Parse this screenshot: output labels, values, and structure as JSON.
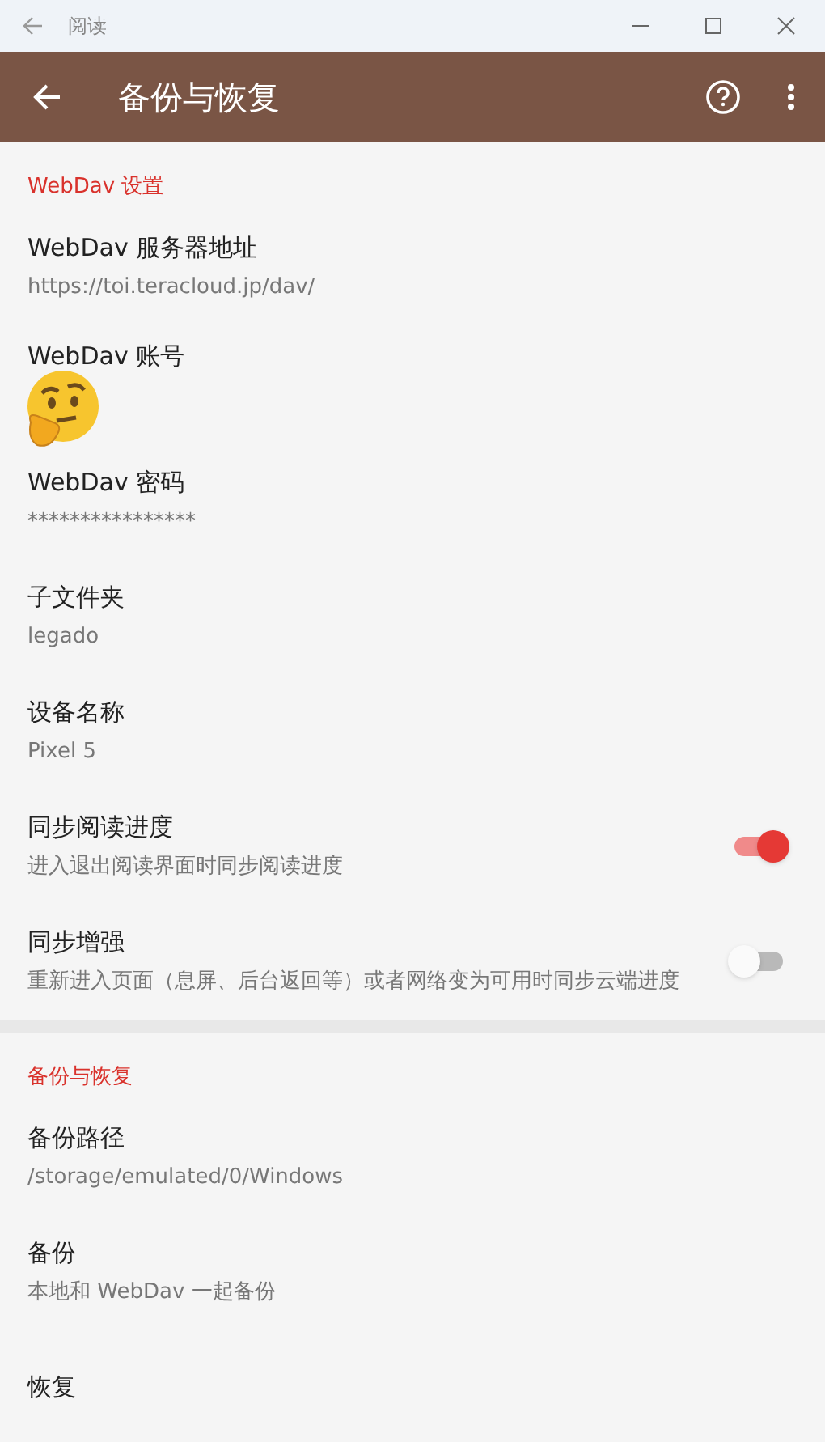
{
  "window": {
    "title": "阅读"
  },
  "app_bar": {
    "title": "备份与恢复"
  },
  "sections": [
    {
      "title": "WebDav 设置",
      "items": [
        {
          "kind": "text",
          "title": "WebDav 服务器地址",
          "summary": "https://toi.teracloud.jp/dav/"
        },
        {
          "kind": "sticker",
          "title": "WebDav 账号"
        },
        {
          "kind": "text",
          "title": "WebDav 密码",
          "summary": "****************"
        },
        {
          "kind": "text",
          "title": "子文件夹",
          "summary": "legado"
        },
        {
          "kind": "text",
          "title": "设备名称",
          "summary": "Pixel 5"
        },
        {
          "kind": "switch",
          "title": "同步阅读进度",
          "summary": "进入退出阅读界面时同步阅读进度",
          "on": true
        },
        {
          "kind": "switch",
          "title": "同步增强",
          "summary": "重新进入页面（息屏、后台返回等）或者网络变为可用时同步云端进度",
          "on": false
        }
      ]
    },
    {
      "title": "备份与恢复",
      "items": [
        {
          "kind": "text",
          "title": "备份路径",
          "summary": "/storage/emulated/0/Windows"
        },
        {
          "kind": "text",
          "title": "备份",
          "summary": "本地和 WebDav 一起备份"
        },
        {
          "kind": "text",
          "title": "恢复"
        }
      ]
    }
  ]
}
